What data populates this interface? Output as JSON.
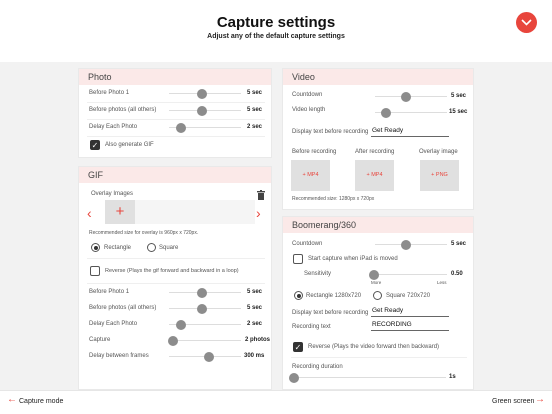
{
  "header": {
    "title": "Capture settings",
    "subtitle": "Adjust any of the default capture settings"
  },
  "photo": {
    "title": "Photo",
    "rows": [
      {
        "label": "Before Photo 1",
        "value": "5 sec"
      },
      {
        "label": "Before photos (all others)",
        "value": "5 sec"
      },
      {
        "label": "Delay Each Photo",
        "value": "2 sec"
      }
    ],
    "checkbox": "Also generate GIF"
  },
  "gif": {
    "title": "GIF",
    "overlay_label": "Overlay Images",
    "add": "+",
    "prev": "‹",
    "next": "›",
    "recommended": "Recommended size for overlay is 960px x 720px.",
    "radio_rect": "Rectangle",
    "radio_square": "Square",
    "reverse": "Reverse  (Plays the gif forward and backward in a loop)",
    "rows": [
      {
        "label": "Before Photo 1",
        "value": "5 sec"
      },
      {
        "label": "Before photos (all others)",
        "value": "5 sec"
      },
      {
        "label": "Delay Each Photo",
        "value": "2 sec"
      },
      {
        "label": "Capture",
        "value": "2 photos"
      },
      {
        "label": "Delay between frames",
        "value": "300 ms"
      }
    ]
  },
  "video": {
    "title": "Video",
    "countdown_label": "Countdown",
    "countdown_value": "5 sec",
    "length_label": "Video length",
    "length_value": "15 sec",
    "display_label": "Display text before recording",
    "display_value": "Get Ready",
    "before_label": "Before recording",
    "after_label": "After recording",
    "overlay_label": "Overlay image",
    "before_ph": "+ MP4",
    "after_ph": "+ MP4",
    "overlay_ph": "+ PNG",
    "recommended": "Recommended size: 1280px x 720px"
  },
  "boomerang": {
    "title": "Boomerang/360",
    "countdown_label": "Countdown",
    "countdown_value": "5 sec",
    "ipad_label": "Start capture when iPad is moved",
    "sensitivity_label": "Sensitivity",
    "sensitivity_value": "0.50",
    "more": "More",
    "less": "Less",
    "radio_rect": "Rectangle 1280x720",
    "radio_square": "Square 720x720",
    "display_label": "Display text before recording",
    "display_value": "Get Ready",
    "rec_label": "Recording text",
    "rec_value": "RECORDING",
    "reverse": "Reverse (Plays the video forward then backward)",
    "duration_label": "Recording duration",
    "duration_value": "1s"
  },
  "footer": {
    "left": "Capture mode",
    "right": "Green screen"
  },
  "colors": {
    "accent": "#e8453c",
    "header_bg": "#fbe9e8"
  }
}
